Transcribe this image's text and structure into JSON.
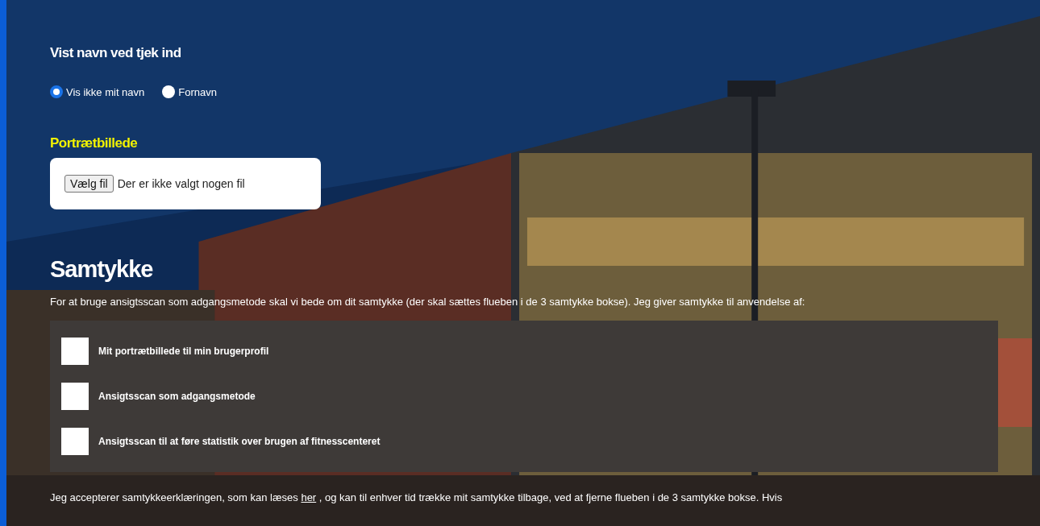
{
  "display_name": {
    "title": "Vist navn ved tjek ind",
    "options": [
      {
        "label": "Vis ikke mit navn",
        "selected": true
      },
      {
        "label": "Fornavn",
        "selected": false
      }
    ]
  },
  "portrait": {
    "title": "Portrætbillede",
    "button": "Vælg fil",
    "status": "Der er ikke valgt nogen fil"
  },
  "consent": {
    "title": "Samtykke",
    "intro": "For at bruge ansigtsscan som adgangsmetode skal vi bede om dit samtykke (der skal sættes flueben i de 3 samtykke bokse). Jeg giver samtykke til anvendelse af:",
    "items": [
      {
        "label": "Mit portrætbillede til min brugerprofil",
        "checked": false
      },
      {
        "label": "Ansigtsscan som adgangsmetode",
        "checked": false
      },
      {
        "label": "Ansigtsscan til at føre statistik over brugen af fitnesscenteret",
        "checked": false
      }
    ],
    "footer": {
      "before": "Jeg accepterer samtykkeerklæringen, som kan læses ",
      "link": "her",
      "after": " , og kan til enhver tid trække mit samtykke tilbage, ved at fjerne flueben i de 3 samtykke bokse. Hvis"
    }
  }
}
